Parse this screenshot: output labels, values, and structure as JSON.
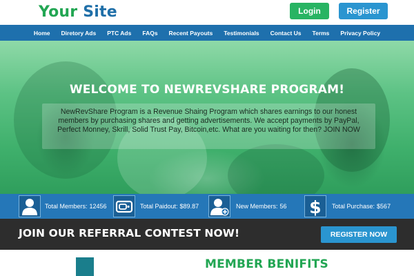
{
  "header": {
    "logo_part1": "Your ",
    "logo_part2": "Site",
    "login_label": "Login",
    "register_label": "Register"
  },
  "nav": {
    "items": [
      "Home",
      "Diretory Ads",
      "PTC Ads",
      "FAQs",
      "Recent Payouts",
      "Testimonials",
      "Contact Us",
      "Terms",
      "Privacy Policy"
    ]
  },
  "hero": {
    "title": "WELCOME TO NEWREVSHARE PROGRAM!",
    "description": "NewRevShare Program is a Revenue Shaing Program which shares earnings to our honest members by purchasing shares and getting advertisements. We accept payments by PayPal, Perfect Monney, Skrill, Solid Trust Pay, Bitcoin,etc. What are you waiting for then? JOIN NOW"
  },
  "stats": [
    {
      "label": "Total Members:",
      "value": "12456",
      "icon": "user-icon"
    },
    {
      "label": "Total Paidout:",
      "value": "$89.87",
      "icon": "wallet-icon"
    },
    {
      "label": "New Members:",
      "value": "56",
      "icon": "user-add-icon"
    },
    {
      "label": "Total Purchase:",
      "value": "$567",
      "icon": "dollar-icon"
    }
  ],
  "contest": {
    "title": "JOIN OUR REFERRAL CONTEST NOW!",
    "button_label": "REGISTER NOW"
  },
  "benefits": {
    "title": "MEMBER BENIFITS"
  },
  "colors": {
    "brand_green": "#22a653",
    "brand_blue": "#1f6fa8",
    "nav_bg": "#1e70ad",
    "stats_bg": "#2577b8",
    "contest_bg": "#2d2d2d"
  }
}
